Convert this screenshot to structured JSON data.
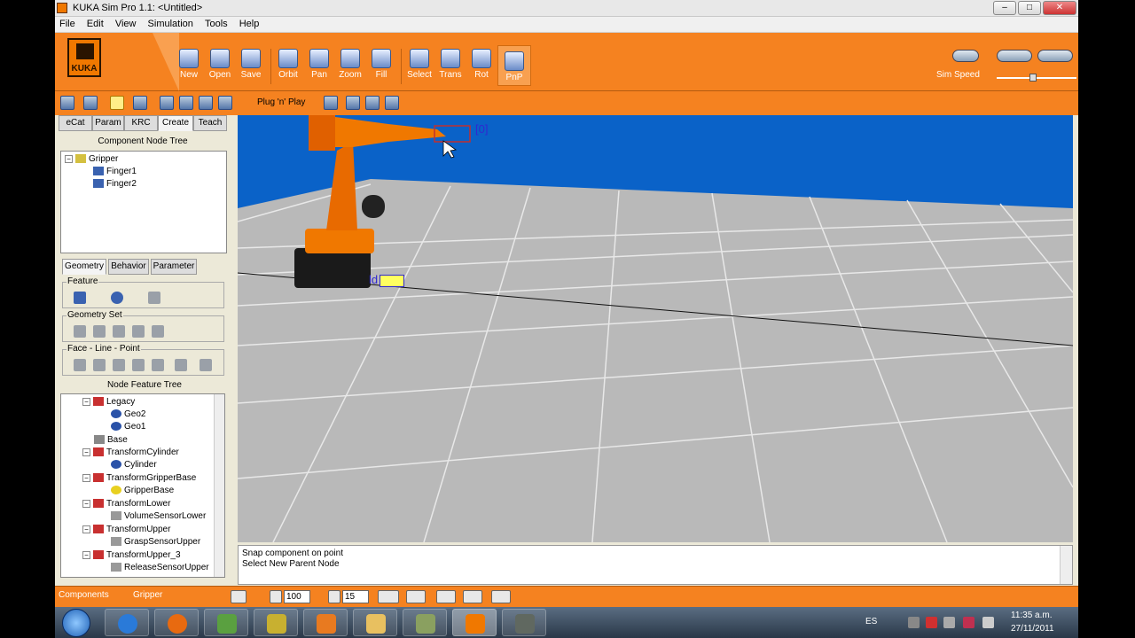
{
  "window": {
    "title": "KUKA Sim Pro 1.1: <Untitled>",
    "min_symbol": "–",
    "max_symbol": "□",
    "close_symbol": "✕"
  },
  "menu": [
    "File",
    "Edit",
    "View",
    "Simulation",
    "Tools",
    "Help"
  ],
  "logo_text": "KUKA",
  "toolbar": {
    "buttons": [
      {
        "label": "New",
        "icon": "new-document-icon"
      },
      {
        "label": "Open",
        "icon": "open-folder-icon"
      },
      {
        "label": "Save",
        "icon": "save-disk-icon"
      },
      {
        "label": "Orbit",
        "icon": "orbit-icon"
      },
      {
        "label": "Pan",
        "icon": "pan-arrows-icon"
      },
      {
        "label": "Zoom",
        "icon": "zoom-icon"
      },
      {
        "label": "Fill",
        "icon": "fill-cube-icon"
      },
      {
        "label": "Select",
        "icon": "select-arrow-icon"
      },
      {
        "label": "Trans",
        "icon": "translate-icon"
      },
      {
        "label": "Rot",
        "icon": "rotate-icon"
      },
      {
        "label": "PnP",
        "icon": "plug-and-play-icon"
      }
    ],
    "sim_speed_label": "Sim Speed",
    "sim_speed_value_percent": 45
  },
  "toolbar2": {
    "plug_label": "Plug 'n' Play"
  },
  "left_panel": {
    "tabs": [
      "eCat",
      "Param",
      "KRC",
      "Create",
      "Teach"
    ],
    "selected_tab": "Create",
    "component_tree_title": "Component Node Tree",
    "component_tree": [
      {
        "label": "Gripper",
        "level": 0
      },
      {
        "label": "Finger1",
        "level": 1
      },
      {
        "label": "Finger2",
        "level": 1
      }
    ],
    "sub_tabs": [
      "Geometry",
      "Behavior",
      "Parameter"
    ],
    "selected_sub_tab": "Geometry",
    "groups": {
      "feature": "Feature",
      "geometry_set": "Geometry Set",
      "face_line_point": "Face - Line - Point"
    },
    "feature_tree_title": "Node Feature Tree",
    "feature_tree": [
      {
        "label": "Legacy",
        "level": 1,
        "kind": "transform"
      },
      {
        "label": "Geo2",
        "level": 2,
        "kind": "geo"
      },
      {
        "label": "Geo1",
        "level": 2,
        "kind": "geo"
      },
      {
        "label": "Base",
        "level": 1,
        "kind": "frame"
      },
      {
        "label": "TransformCylinder",
        "level": 1,
        "kind": "transform"
      },
      {
        "label": "Cylinder",
        "level": 2,
        "kind": "geo"
      },
      {
        "label": "TransformGripperBase",
        "level": 1,
        "kind": "transform"
      },
      {
        "label": "GripperBase",
        "level": 2,
        "kind": "geo-yellow"
      },
      {
        "label": "TransformLower",
        "level": 1,
        "kind": "transform"
      },
      {
        "label": "VolumeSensorLower",
        "level": 2,
        "kind": "sensor"
      },
      {
        "label": "TransformUpper",
        "level": 1,
        "kind": "transform"
      },
      {
        "label": "GraspSensorUpper",
        "level": 2,
        "kind": "sensor"
      },
      {
        "label": "TransformUpper_3",
        "level": 1,
        "kind": "transform"
      },
      {
        "label": "ReleaseSensorUpper",
        "level": 2,
        "kind": "sensor"
      }
    ]
  },
  "viewport": {
    "label_tool": "[0]",
    "label_base": "ld"
  },
  "output": {
    "line1": "Snap component on point",
    "line2": "Select New Parent Node"
  },
  "statusbar": {
    "components_label": "Components",
    "current_component": "Gripper",
    "grid_value": "100",
    "snap_value": "15"
  },
  "taskbar": {
    "lang": "ES",
    "time": "11:35 a.m.",
    "date": "27/11/2011"
  }
}
